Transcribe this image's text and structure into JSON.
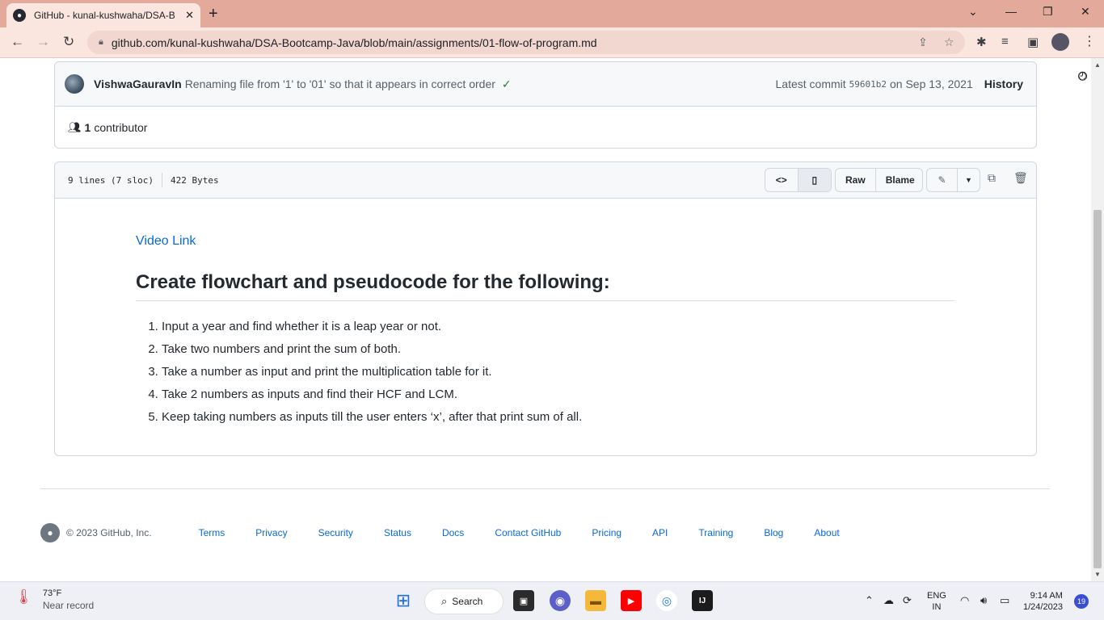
{
  "browser": {
    "tab_title": "GitHub - kunal-kushwaha/DSA-B",
    "url": "github.com/kunal-kushwaha/DSA-Bootcamp-Java/blob/main/assignments/01-flow-of-program.md"
  },
  "commit": {
    "author": "VishwaGauravIn",
    "message": "Renaming file from '1' to '01' so that it appears in correct order",
    "latest_label": "Latest commit",
    "sha": "59601b2",
    "date_text": "on Sep 13, 2021",
    "history_label": "History",
    "contributor_count": "1",
    "contributor_label": "contributor"
  },
  "file": {
    "lines": "9 lines (7 sloc)",
    "size": "422 Bytes",
    "raw_label": "Raw",
    "blame_label": "Blame"
  },
  "content": {
    "video_link": "Video Link",
    "heading": "Create flowchart and pseudocode for the following:",
    "tasks": [
      "Input a year and find whether it is a leap year or not.",
      "Take two numbers and print the sum of both.",
      "Take a number as input and print the multiplication table for it.",
      "Take 2 numbers as inputs and find their HCF and LCM.",
      "Keep taking numbers as inputs till the user enters ‘x’, after that print sum of all."
    ]
  },
  "footer": {
    "copyright": "© 2023 GitHub, Inc.",
    "links": [
      "Terms",
      "Privacy",
      "Security",
      "Status",
      "Docs",
      "Contact GitHub",
      "Pricing",
      "API",
      "Training",
      "Blog",
      "About"
    ]
  },
  "taskbar": {
    "temperature": "73°F",
    "weather_desc": "Near record",
    "search_label": "Search",
    "lang_line1": "ENG",
    "lang_line2": "IN",
    "time": "9:14 AM",
    "date": "1/24/2023",
    "notification_count": "19"
  }
}
